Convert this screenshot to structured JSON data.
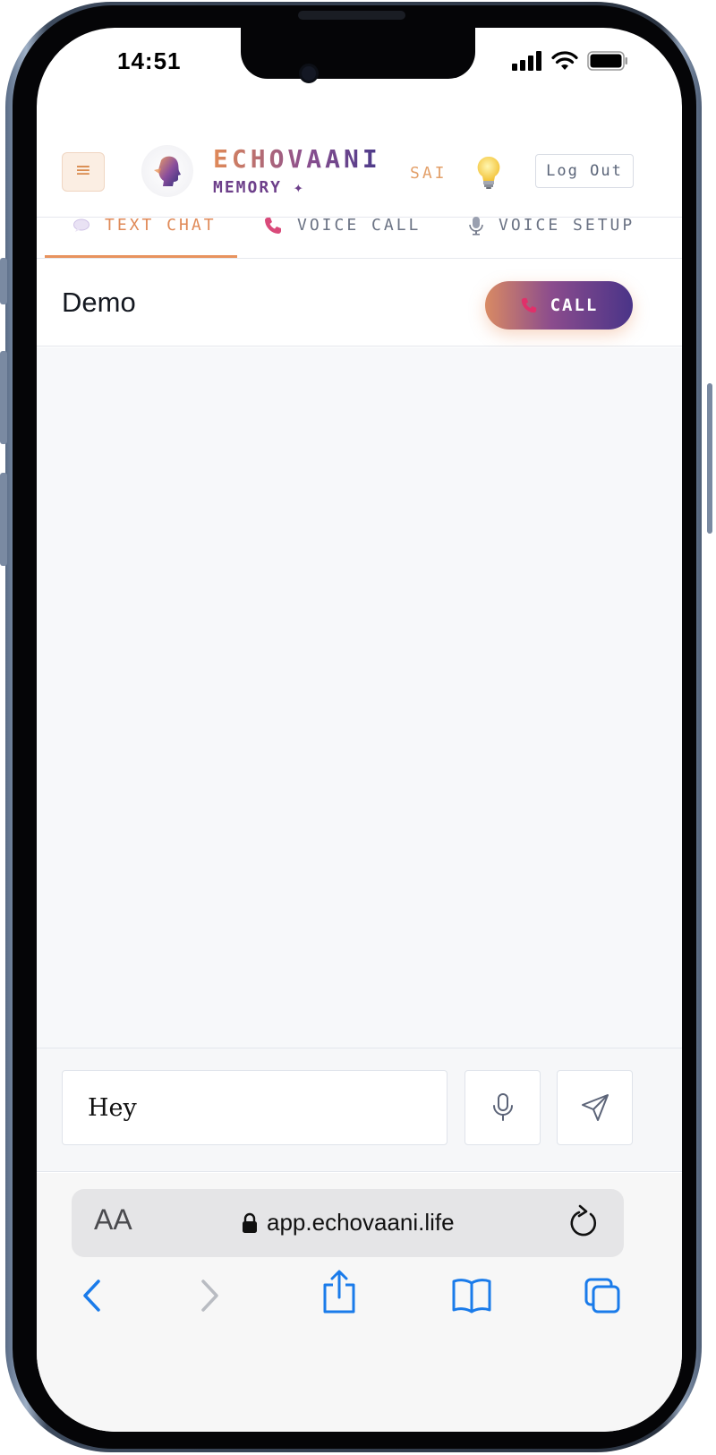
{
  "status_bar": {
    "time": "14:51"
  },
  "header": {
    "menu_icon": "≡",
    "brand_title": "ECHOVAANI",
    "brand_subtitle": "MEMORY ✦",
    "user_name": "SAI",
    "logout_label": "Log Out"
  },
  "tabs": [
    {
      "label": "TEXT CHAT",
      "icon": "chat-bubble-icon",
      "active": true
    },
    {
      "label": "VOICE CALL",
      "icon": "phone-icon",
      "active": false
    },
    {
      "label": "VOICE SETUP",
      "icon": "microphone-icon",
      "active": false
    }
  ],
  "chat": {
    "title": "Demo",
    "call_label": "CALL",
    "input_value": "Hey"
  },
  "browser": {
    "text_size_label": "AA",
    "url": "app.echovaani.life"
  },
  "colors": {
    "accent_orange": "#e08a58",
    "accent_purple": "#4a3488",
    "chat_background": "#f7f8fa"
  }
}
